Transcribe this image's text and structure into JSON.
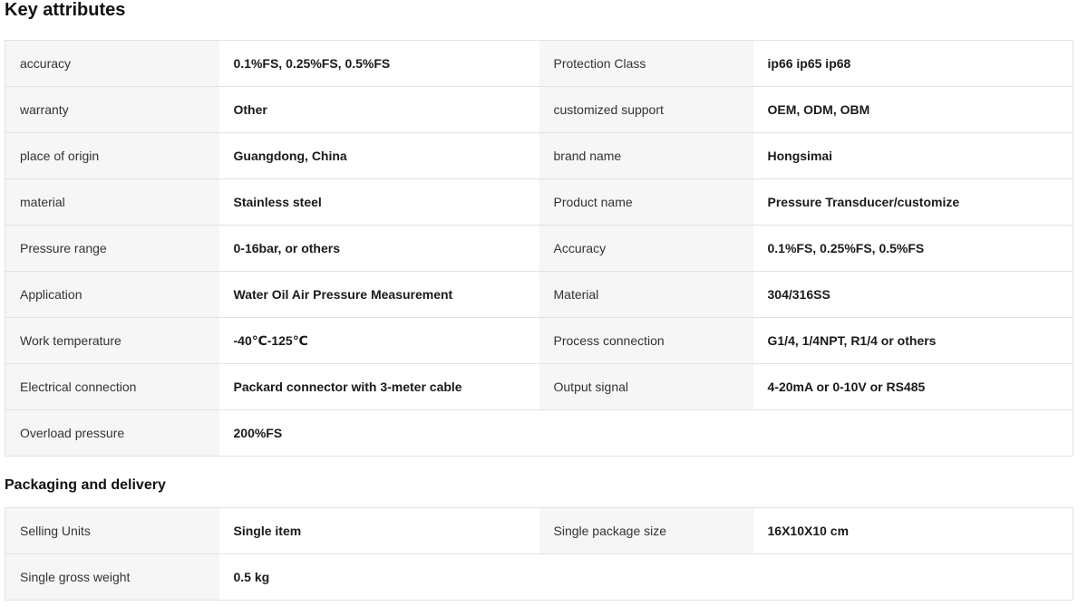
{
  "key_attributes": {
    "title": "Key attributes",
    "rows": [
      [
        {
          "label": "accuracy",
          "value": "0.1%FS, 0.25%FS, 0.5%FS"
        },
        {
          "label": "Protection Class",
          "value": "ip66 ip65 ip68"
        }
      ],
      [
        {
          "label": "warranty",
          "value": "Other"
        },
        {
          "label": "customized support",
          "value": "OEM, ODM, OBM"
        }
      ],
      [
        {
          "label": "place of origin",
          "value": "Guangdong, China"
        },
        {
          "label": "brand name",
          "value": "Hongsimai"
        }
      ],
      [
        {
          "label": "material",
          "value": "Stainless steel"
        },
        {
          "label": "Product name",
          "value": "Pressure Transducer/customize"
        }
      ],
      [
        {
          "label": "Pressure range",
          "value": "0-16bar, or others"
        },
        {
          "label": "Accuracy",
          "value": "0.1%FS, 0.25%FS, 0.5%FS"
        }
      ],
      [
        {
          "label": "Application",
          "value": "Water Oil Air Pressure Measurement"
        },
        {
          "label": "Material",
          "value": "304/316SS"
        }
      ],
      [
        {
          "label": "Work temperature",
          "value": "-40℃-125℃"
        },
        {
          "label": "Process connection",
          "value": "G1/4, 1/4NPT, R1/4 or others"
        }
      ],
      [
        {
          "label": "Electrical connection",
          "value": "Packard connector with 3-meter cable"
        },
        {
          "label": "Output signal",
          "value": "4-20mA or 0-10V or RS485"
        }
      ],
      [
        {
          "label": "Overload pressure",
          "value": "200%FS"
        }
      ]
    ]
  },
  "packaging": {
    "title": "Packaging and delivery",
    "rows": [
      [
        {
          "label": "Selling Units",
          "value": "Single item"
        },
        {
          "label": "Single package size",
          "value": "16X10X10 cm"
        }
      ],
      [
        {
          "label": "Single gross weight",
          "value": "0.5 kg"
        }
      ]
    ]
  }
}
